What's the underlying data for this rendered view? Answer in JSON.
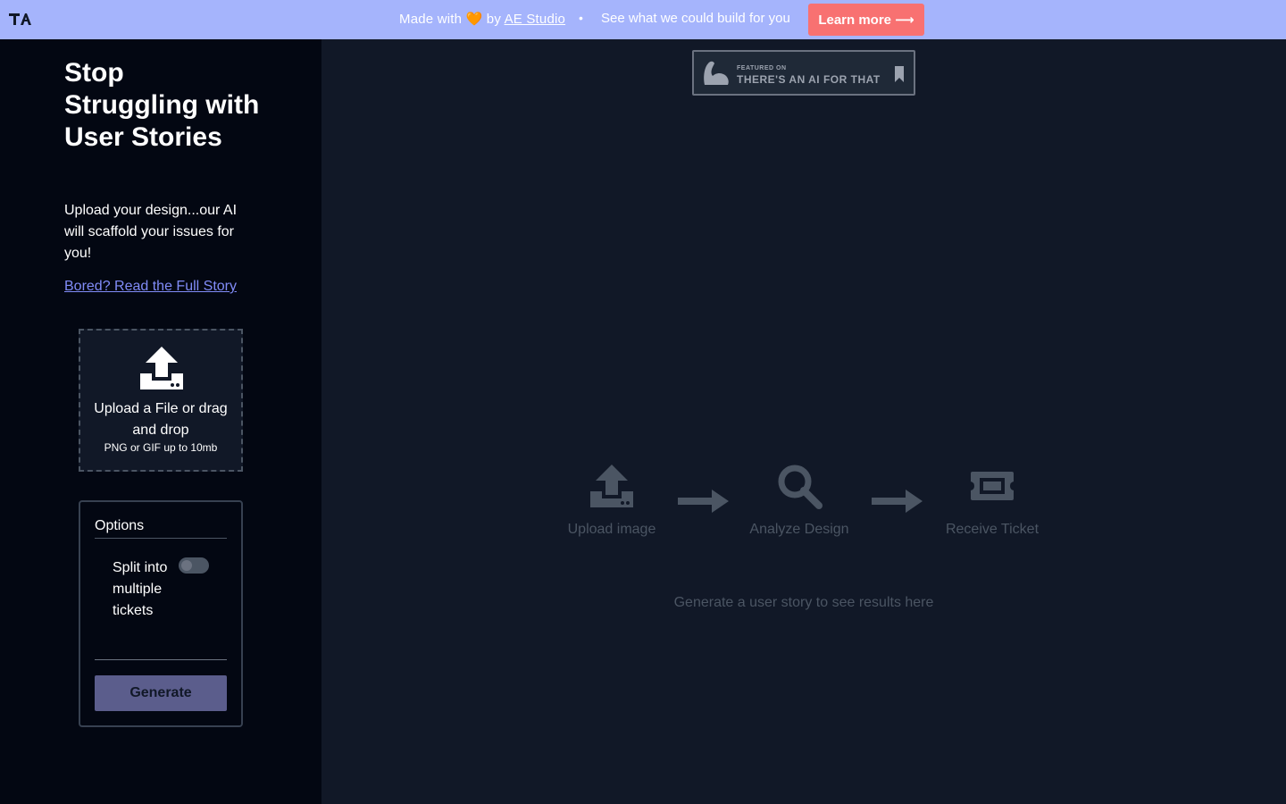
{
  "banner": {
    "made_with": "Made with 🧡 by ",
    "studio_link": "AE Studio",
    "separator": "•",
    "tagline": "See what we could build for you",
    "learn_more": "Learn more ⟶"
  },
  "sidebar": {
    "title": "Stop Struggling with User Stories",
    "subtitle": "Upload your design...our AI will scaffold your issues for you!",
    "story_link": "Bored? Read the Full Story",
    "upload": {
      "main": "Upload a File or drag and drop",
      "hint": "PNG or GIF up to 10mb"
    },
    "options": {
      "title": "Options",
      "split_label": "Split into multiple tickets",
      "split_enabled": false,
      "generate_label": "Generate"
    }
  },
  "main": {
    "featured": {
      "small": "FEATURED ON",
      "big": "THERE'S AN AI FOR THAT"
    },
    "steps": [
      {
        "label": "Upload image",
        "icon": "upload-icon"
      },
      {
        "label": "Analyze Design",
        "icon": "search-icon"
      },
      {
        "label": "Receive Ticket",
        "icon": "ticket-icon"
      }
    ],
    "empty_message": "Generate a user story to see results here"
  },
  "colors": {
    "banner_bg": "#a5b4fc",
    "learn_more_bg": "#f87171",
    "sidebar_bg": "#030712",
    "main_bg": "#111827",
    "link": "#818cf8",
    "generate_bg": "#5b5d8c",
    "muted": "#4b5563"
  }
}
